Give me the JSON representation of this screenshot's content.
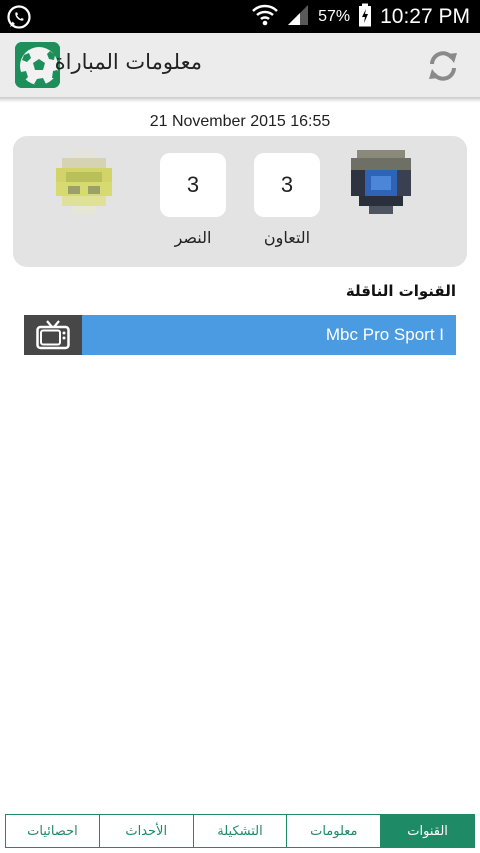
{
  "status_bar": {
    "battery_percent": "57%",
    "time": "10:27 PM",
    "icons": [
      "whatsapp-icon",
      "wifi-icon",
      "signal-icon",
      "battery-charging-icon"
    ]
  },
  "app_bar": {
    "title": "معلومات المباراة",
    "refresh_icon": "refresh-icon",
    "logo_icon": "soccer-ball-icon"
  },
  "match": {
    "date": "21 November 2015 16:55",
    "home": {
      "name": "التعاون",
      "score": "3"
    },
    "away": {
      "name": "النصر",
      "score": "3"
    }
  },
  "channels": {
    "section_title": "القنوات الناقلة",
    "items": [
      {
        "name": "Mbc Pro Sport I",
        "icon": "tv-icon"
      }
    ]
  },
  "tabs": [
    {
      "label": "القنوات",
      "active": true
    },
    {
      "label": "معلومات",
      "active": false
    },
    {
      "label": "التشكيلة",
      "active": false
    },
    {
      "label": "الأحداث",
      "active": false
    },
    {
      "label": "احصائيات",
      "active": false
    }
  ],
  "colors": {
    "accent_green": "#1e8a66",
    "channel_blue": "#4a9be2",
    "card_grey": "#e3e3e3"
  }
}
